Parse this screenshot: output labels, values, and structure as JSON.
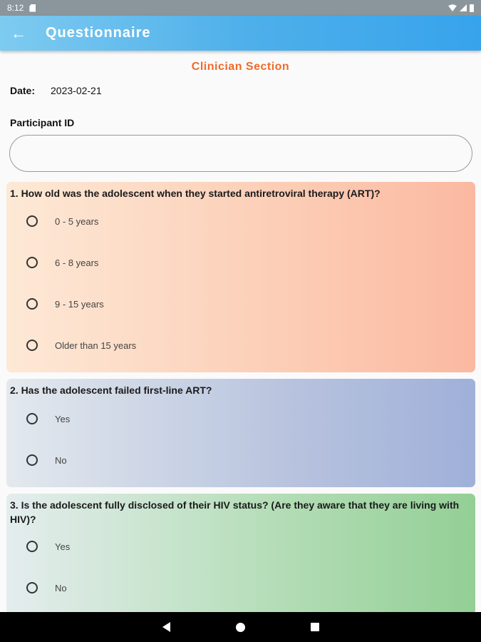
{
  "status_bar": {
    "time": "8:12",
    "icons": [
      "sd-card-icon",
      "wifi-icon",
      "signal-icon",
      "battery-icon"
    ]
  },
  "app_bar": {
    "back_icon": "arrow-left-icon",
    "title": "Questionnaire",
    "gradient": [
      "#7ecbf0",
      "#37a3ec"
    ]
  },
  "form": {
    "section_title": "Clinician Section",
    "date_label": "Date:",
    "date_value": "2023-02-21",
    "participant_label": "Participant ID",
    "participant_value": "",
    "participant_placeholder": ""
  },
  "questions": [
    {
      "text": "1. How old was the adolescent when they started antiretroviral therapy (ART)?",
      "options": [
        "0 - 5 years",
        "6 - 8 years",
        "9 - 15 years",
        "Older than 15 years"
      ],
      "selected": null
    },
    {
      "text": "2. Has the adolescent failed first-line ART?",
      "options": [
        "Yes",
        "No"
      ],
      "selected": null
    },
    {
      "text": "3. Is the adolescent fully disclosed of their HIV status? (Are they aware that they are living with HIV)?",
      "options": [
        "Yes",
        "No"
      ],
      "selected": null
    }
  ],
  "colors": {
    "accent": "#f06a2a",
    "q1_gradient": [
      "#fde9d6",
      "#fbb8a1"
    ],
    "q2_gradient": [
      "#e3e9ee",
      "#9fb0d9"
    ],
    "q3_gradient": [
      "#e4edee",
      "#93cf95"
    ]
  },
  "nav_bar": {
    "icons": [
      "nav-back-icon",
      "nav-home-icon",
      "nav-recents-icon"
    ]
  }
}
